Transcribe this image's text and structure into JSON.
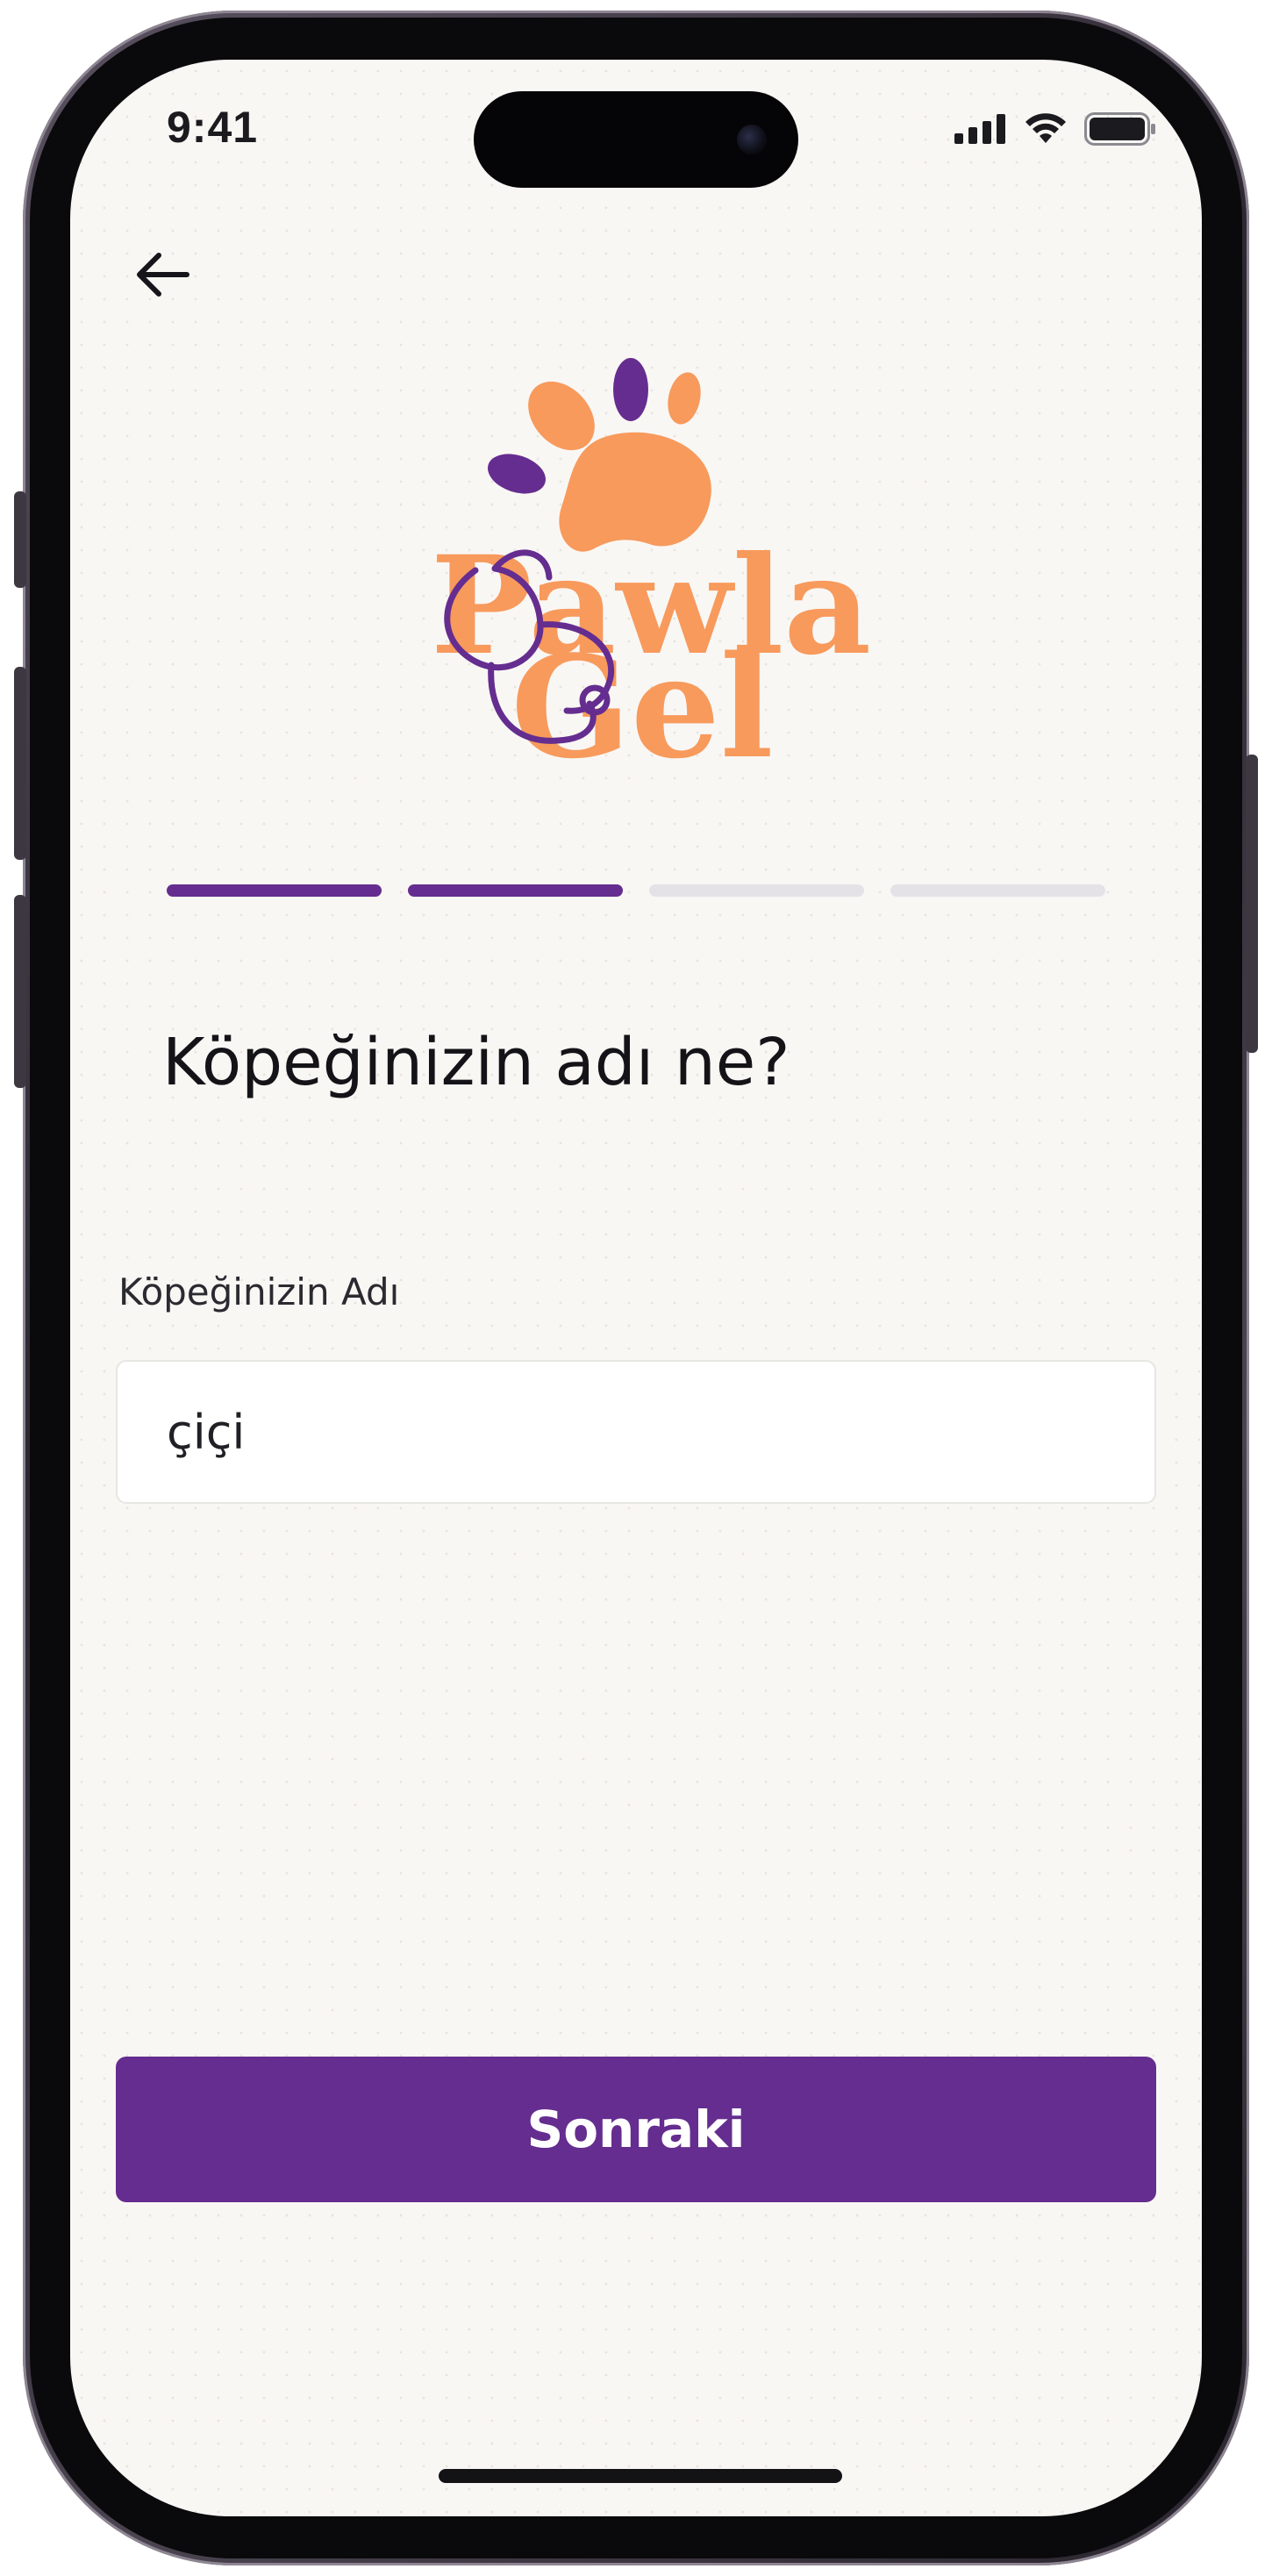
{
  "status_bar": {
    "time": "9:41",
    "icons": [
      "cellular-signal-icon",
      "wifi-icon",
      "battery-icon"
    ]
  },
  "nav": {
    "back_icon": "arrow-left-icon"
  },
  "logo": {
    "line1": "Pawla",
    "line2": "Gel",
    "colors": {
      "orange": "#f79a5c",
      "purple": "#652d8f"
    }
  },
  "progress": {
    "total_steps": 4,
    "completed_steps": 2,
    "active_color": "#652d8f",
    "inactive_color": "#e4e2e6"
  },
  "question": "Köpeğinizin adı ne?",
  "form": {
    "label": "Köpeğinizin Adı",
    "value": "çiçi"
  },
  "next_button": {
    "label": "Sonraki",
    "color": "#652d8f"
  }
}
